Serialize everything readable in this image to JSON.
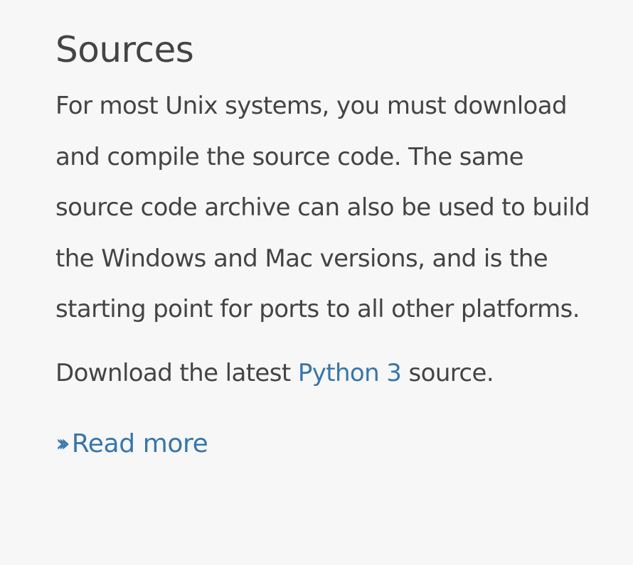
{
  "section": {
    "title": "Sources",
    "paragraph": "For most Unix systems, you must download and compile the source code. The same source code archive can also be used to build the Windows and Mac versions, and is the starting point for ports to all other platforms.",
    "download_prefix": "Download the latest ",
    "download_link": "Python 3",
    "download_suffix": " source.",
    "read_more": "Read more",
    "read_more_icon": "chevrons-right-icon"
  },
  "colors": {
    "text": "#444444",
    "link": "#3776ab",
    "background": "#f7f7f7"
  }
}
